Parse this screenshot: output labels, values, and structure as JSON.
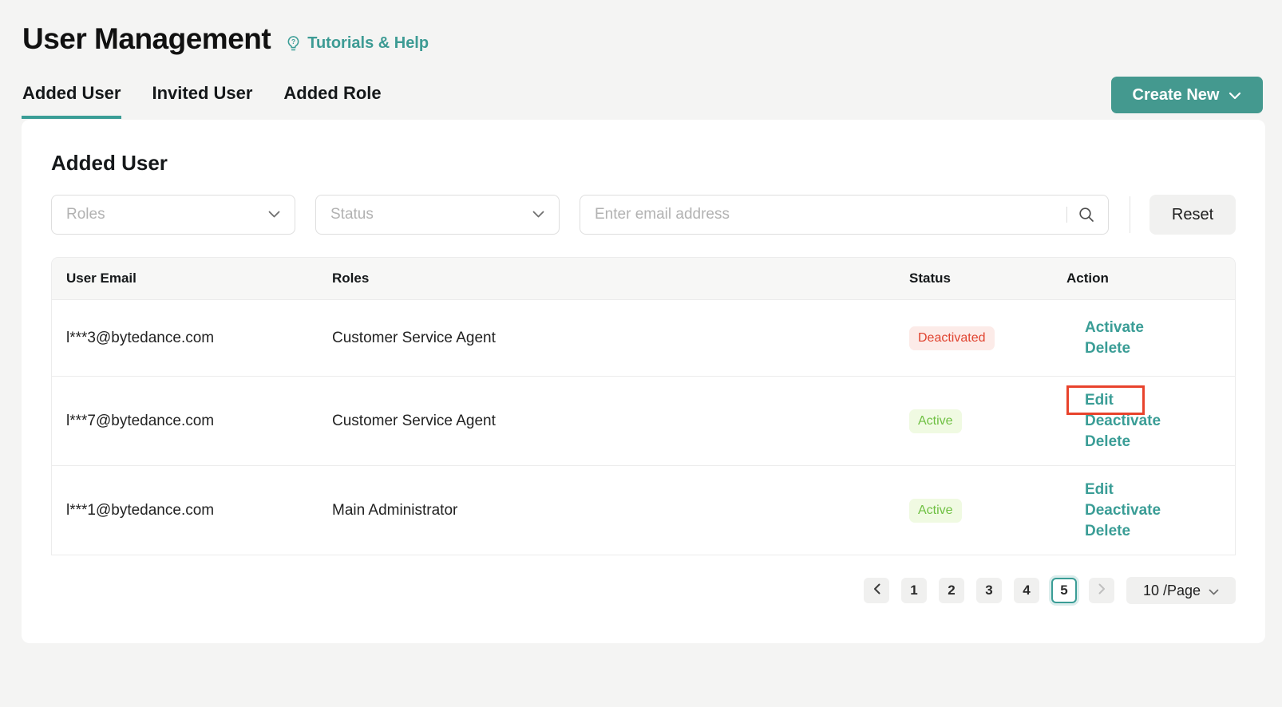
{
  "header": {
    "title": "User Management",
    "help_label": "Tutorials & Help"
  },
  "tabs": [
    {
      "label": "Added User",
      "active": true
    },
    {
      "label": "Invited User",
      "active": false
    },
    {
      "label": "Added Role",
      "active": false
    }
  ],
  "create_new": {
    "label": "Create New"
  },
  "panel": {
    "heading": "Added User",
    "filters": {
      "roles_placeholder": "Roles",
      "status_placeholder": "Status",
      "email_placeholder": "Enter email address",
      "reset_label": "Reset"
    },
    "table": {
      "columns": [
        "User Email",
        "Roles",
        "Status",
        "Action"
      ],
      "rows": [
        {
          "email": "l***3@bytedance.com",
          "role": "Customer Service Agent",
          "status": "Deactivated",
          "status_type": "deactivated",
          "actions": [
            "Activate",
            "Delete"
          ]
        },
        {
          "email": "l***7@bytedance.com",
          "role": "Customer Service Agent",
          "status": "Active",
          "status_type": "active",
          "actions": [
            "Edit",
            "Deactivate",
            "Delete"
          ],
          "highlighted_action": "Edit"
        },
        {
          "email": "l***1@bytedance.com",
          "role": "Main Administrator",
          "status": "Active",
          "status_type": "active",
          "actions": [
            "Edit",
            "Deactivate",
            "Delete"
          ]
        }
      ]
    },
    "pagination": {
      "pages": [
        "1",
        "2",
        "3",
        "4",
        "5"
      ],
      "active_page": "5",
      "page_size_label": "10 /Page"
    }
  },
  "colors": {
    "accent_teal": "#3a9d96",
    "button_teal": "#44998f",
    "status_active_text": "#6fc043",
    "status_active_bg": "#f0fae2",
    "status_deactivated_text": "#e0432f",
    "status_deactivated_bg": "#fcebe8",
    "annotation_red": "#e8432c",
    "page_background": "#f4f4f3"
  }
}
